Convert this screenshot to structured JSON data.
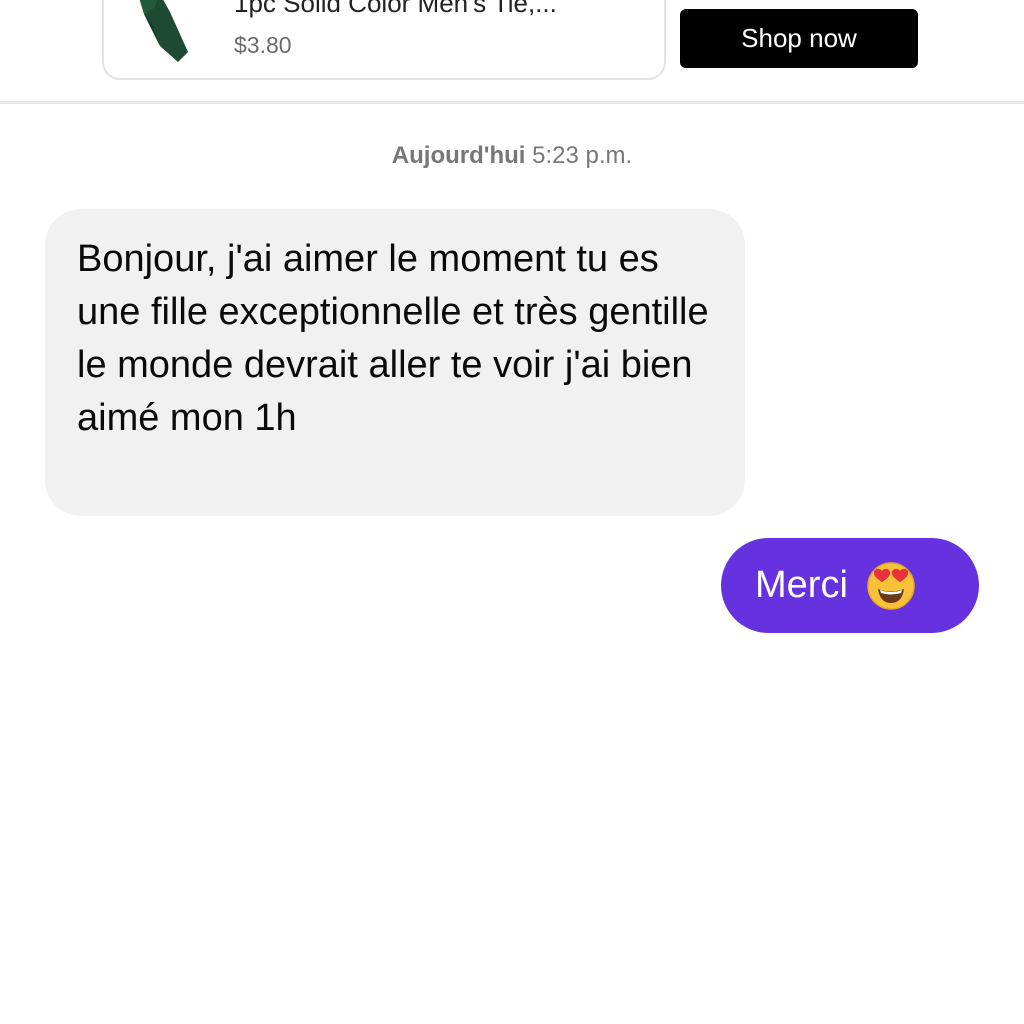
{
  "ad": {
    "title": "1pc Solid Color Men's Tie,...",
    "price": "$3.80",
    "shop_button": "Shop now",
    "icon": "necktie-icon"
  },
  "thread": {
    "timestamp_day": "Aujourd'hui",
    "timestamp_time": "5:23 p.m.",
    "messages": [
      {
        "direction": "incoming",
        "text": "Bonjour, j'ai aimer le moment tu es une fille exceptionnelle et très gentille le monde devrait aller te voir j'ai bien aimé mon 1h"
      },
      {
        "direction": "outgoing",
        "text": "Merci",
        "emoji": "heart-eyes-emoji"
      }
    ]
  },
  "colors": {
    "outgoing_bubble": "#6632e0",
    "incoming_bubble": "#f1f1f1",
    "shop_button": "#000000"
  }
}
